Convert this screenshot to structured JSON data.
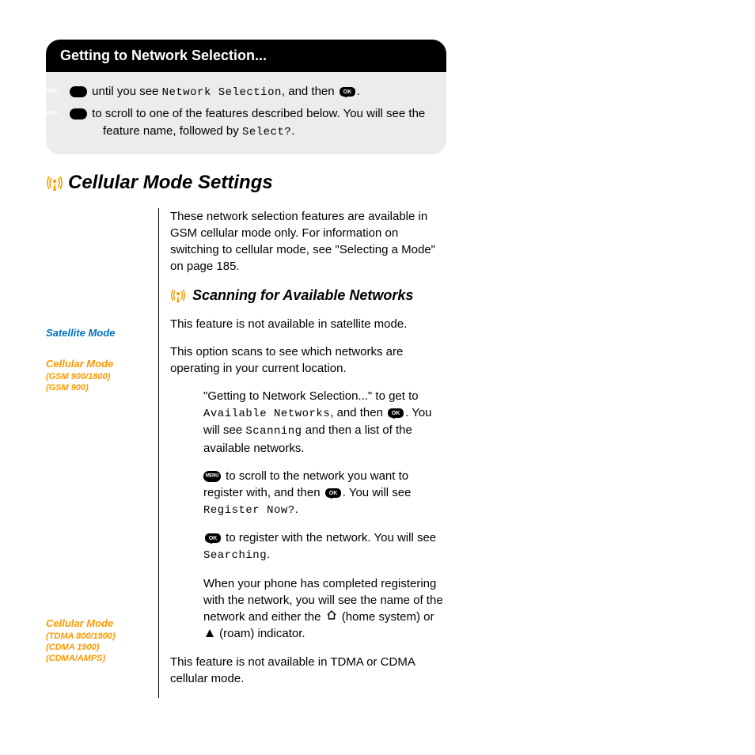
{
  "header": {
    "title": "Getting to Network Selection..."
  },
  "graybox": {
    "step1_pre": " until you see ",
    "step1_netsel": "Network Selection",
    "step1_post": ", and then ",
    "step2_pre": " to scroll to one of the features described below. You will see the feature name, followed by ",
    "step2_select": "Select?",
    "step2_end": "."
  },
  "section": {
    "title": "Cellular Mode Settings",
    "intro": "These network selection features are available in GSM cellular mode only. For information on switching to cellular mode, see \"Selecting a Mode\" on page 185.",
    "subheading": "Scanning for Available Networks"
  },
  "sidebar": {
    "satellite": "Satellite Mode",
    "cellular1": "Cellular Mode",
    "cellular1_sub1": "(GSM 900/1800)",
    "cellular1_sub2": "(GSM 900)",
    "cellular2": "Cellular Mode",
    "cellular2_sub1": "(TDMA 800/1900)",
    "cellular2_sub2": "(CDMA 1900)",
    "cellular2_sub3": "(CDMA/AMPS)"
  },
  "body": {
    "sat_note": "This feature is not available in satellite mode.",
    "cell_note": "This option scans to see which networks are operating in your current location.",
    "p1_a": "\"Getting to Network Selection...\" to get to ",
    "p1_available": "Available Networks",
    "p1_b": ", and then ",
    "p1_c": ". You will see ",
    "p1_scanning": "Scanning",
    "p1_d": " and then a list of the available networks.",
    "p2_a": " to scroll to the network you want to register with, and then ",
    "p2_b": ". You will see ",
    "p2_register": "Register Now?",
    "p2_c": ".",
    "p3_a": " to register with the network. You will see ",
    "p3_searching": "Searching",
    "p3_b": ".",
    "p4": "When your phone has completed registering with the network, you will see the name of the network and either the ",
    "p4_home": " (home system) or ",
    "p4_roam": " (roam) indicator.",
    "tdma_note": "This feature is not available in TDMA or CDMA cellular mode."
  }
}
